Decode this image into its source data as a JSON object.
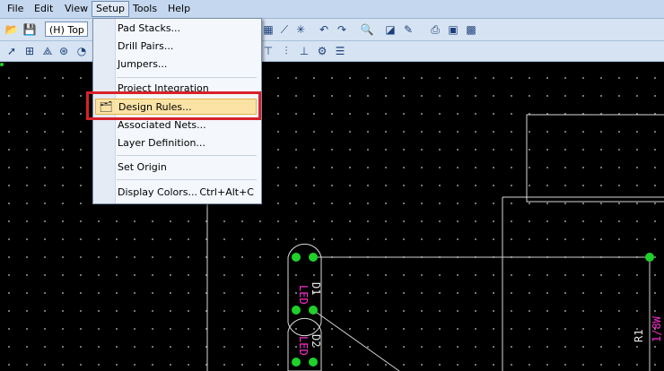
{
  "menubar": {
    "items": [
      {
        "label": "File"
      },
      {
        "label": "Edit"
      },
      {
        "label": "View"
      },
      {
        "label": "Setup"
      },
      {
        "label": "Tools"
      },
      {
        "label": "Help"
      }
    ]
  },
  "toolbar": {
    "layer_select_value": "(H) Top"
  },
  "setup_menu": {
    "items": [
      {
        "label": "Pad Stacks..."
      },
      {
        "label": "Drill Pairs..."
      },
      {
        "label": "Jumpers..."
      },
      {
        "label": "Project Integration"
      },
      {
        "label": "Design Rules..."
      },
      {
        "label": "Associated Nets..."
      },
      {
        "label": "Layer Definition..."
      },
      {
        "label": "Set Origin"
      },
      {
        "label": "Display Colors...",
        "shortcut": "Ctrl+Alt+C"
      }
    ]
  },
  "pcb": {
    "labels": {
      "d1_ref": "D1",
      "d1_val": "LED",
      "d2_ref": "D2",
      "d2_val": "LED",
      "r1_ref": "R1",
      "r1_val": "1/8W"
    }
  },
  "colors": {
    "pad": "#1fd12a",
    "silk": "#ff2fd1",
    "outline": "#d9d9d9",
    "highlight": "#d8222a"
  }
}
